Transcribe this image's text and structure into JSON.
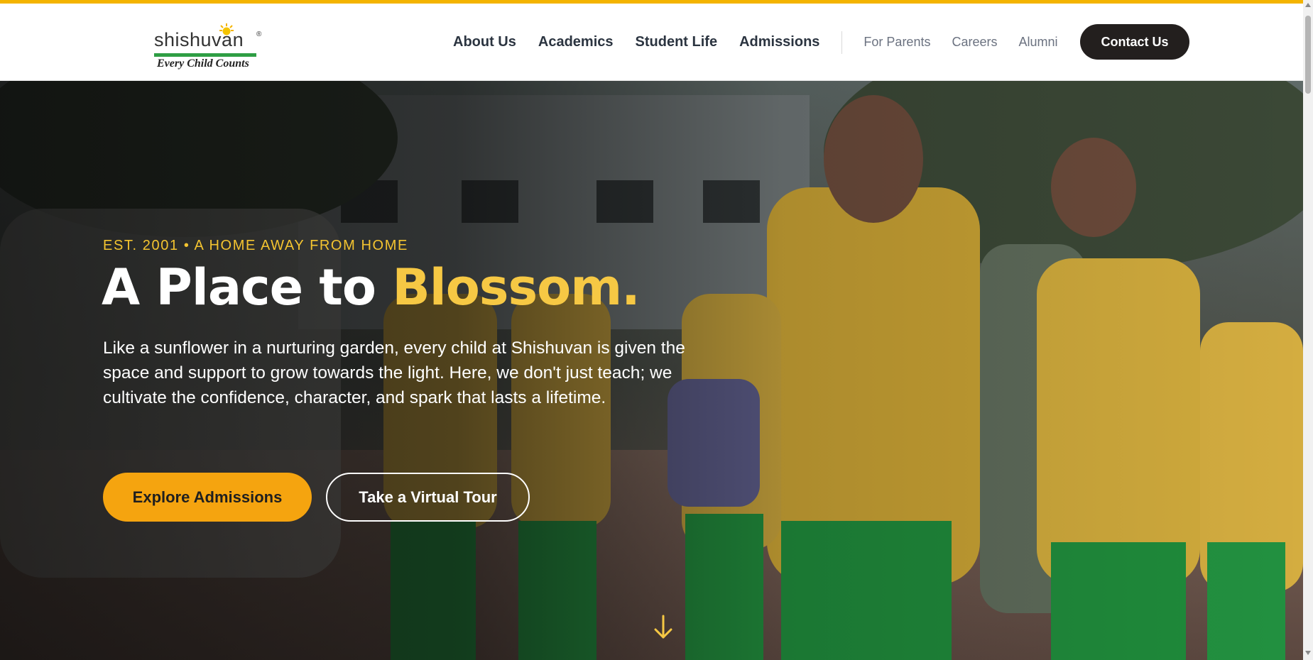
{
  "colors": {
    "accent_bar": "#f4b400",
    "headline_accent": "#f6c844",
    "primary_button": "#f5a40f",
    "contact_button": "#231f1e",
    "logo_green": "#2e9e44"
  },
  "logo": {
    "wordmark": "shishuvan",
    "registered": "®",
    "tagline": "Every Child Counts",
    "icon": "sun-icon"
  },
  "nav": {
    "primary": [
      "About Us",
      "Academics",
      "Student Life",
      "Admissions"
    ],
    "secondary": [
      "For Parents",
      "Careers",
      "Alumni"
    ],
    "cta": "Contact Us"
  },
  "hero": {
    "eyebrow": "EST. 2001 • A HOME AWAY FROM HOME",
    "headline_main": "A Place to ",
    "headline_accent": "Blossom.",
    "lede": "Like a sunflower in a nurturing garden, every child at Shishuvan is given the space and support to grow towards the light. Here, we don't just teach; we cultivate the confidence, character, and spark that lasts a lifetime.",
    "primary_button": "Explore Admissions",
    "secondary_button": "Take a Virtual Tour",
    "scroll_icon": "arrow-down-icon",
    "background_image": "photo of students in yellow shirts and green trousers walking outdoors"
  }
}
